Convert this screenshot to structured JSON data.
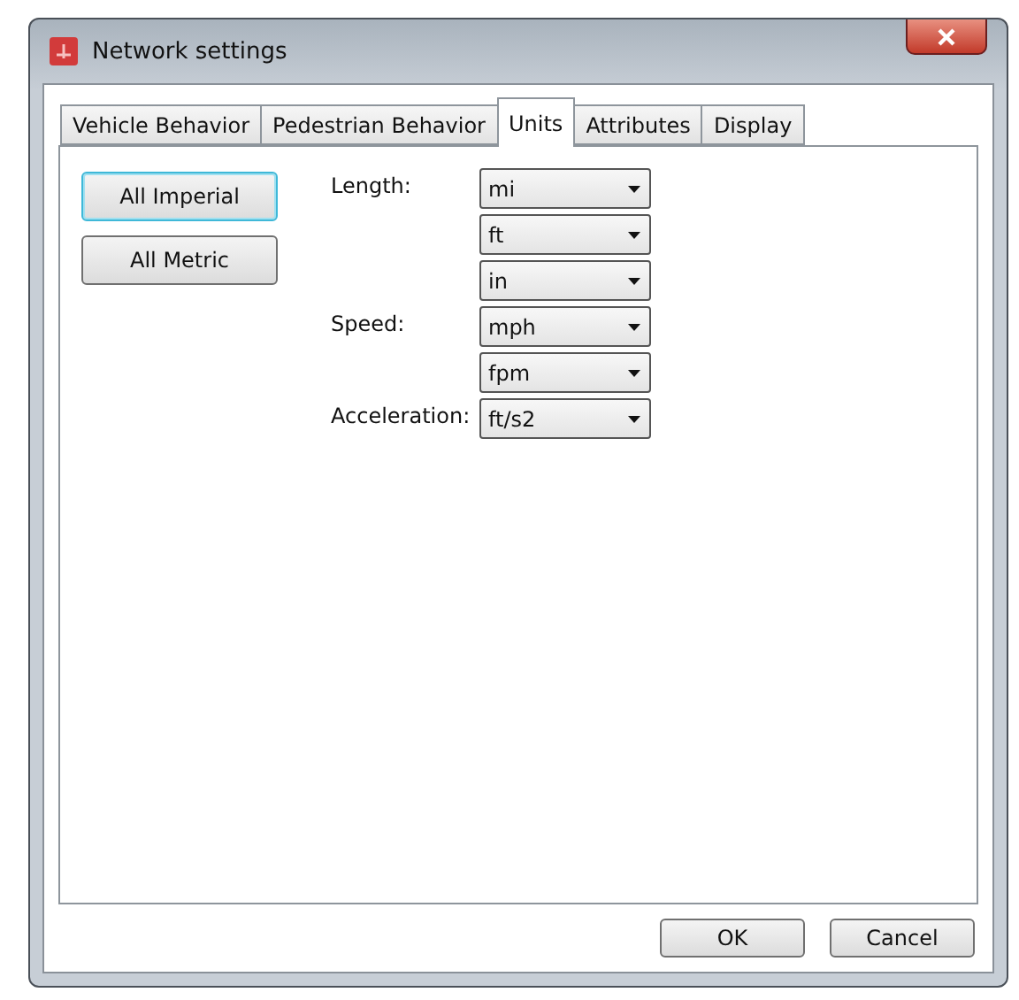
{
  "window": {
    "title": "Network settings"
  },
  "tabs": [
    {
      "label": "Vehicle Behavior",
      "selected": false
    },
    {
      "label": "Pedestrian Behavior",
      "selected": false
    },
    {
      "label": "Units",
      "selected": true
    },
    {
      "label": "Attributes",
      "selected": false
    },
    {
      "label": "Display",
      "selected": false
    }
  ],
  "presets": [
    {
      "label": "All Imperial",
      "focused": true
    },
    {
      "label": "All Metric",
      "focused": false
    }
  ],
  "unit_rows": [
    {
      "label": "Length:",
      "value": "mi"
    },
    {
      "value": "ft"
    },
    {
      "value": "in"
    },
    {
      "label": "Speed:",
      "value": "mph"
    },
    {
      "value": "fpm"
    },
    {
      "label": "Acceleration:",
      "value": "ft/s2"
    }
  ],
  "buttons": [
    "OK",
    "Cancel"
  ]
}
